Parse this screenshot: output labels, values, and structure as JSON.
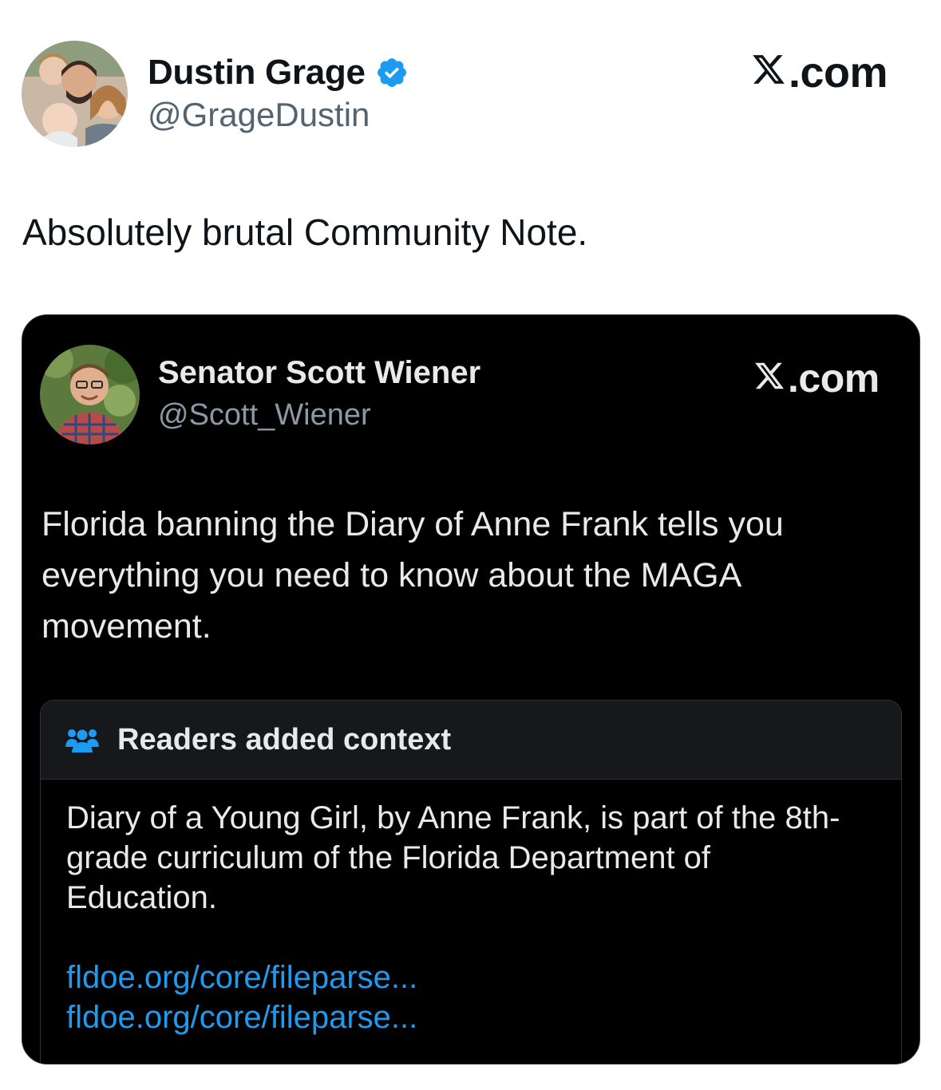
{
  "outer_tweet": {
    "author_name": "Dustin Grage",
    "author_handle": "@GrageDustin",
    "site_label": ".com",
    "text": "Absolutely brutal Community Note.",
    "verified_icon": "verified-badge-icon",
    "accent_color": "#1d9bf0"
  },
  "embedded_tweet": {
    "author_name": "Senator Scott Wiener",
    "author_handle": "@Scott_Wiener",
    "site_label": ".com",
    "text": "Florida banning the Diary of Anne Frank tells you everything you need to know about the MAGA movement.",
    "community_note": {
      "header_icon": "people-icon",
      "header": "Readers added context",
      "body": "Diary of a Young Girl, by Anne Frank, is part of the 8th-grade curriculum of the Florida Department of Education.",
      "links": [
        "fldoe.org/core/fileparse...",
        "fldoe.org/core/fileparse..."
      ]
    }
  }
}
